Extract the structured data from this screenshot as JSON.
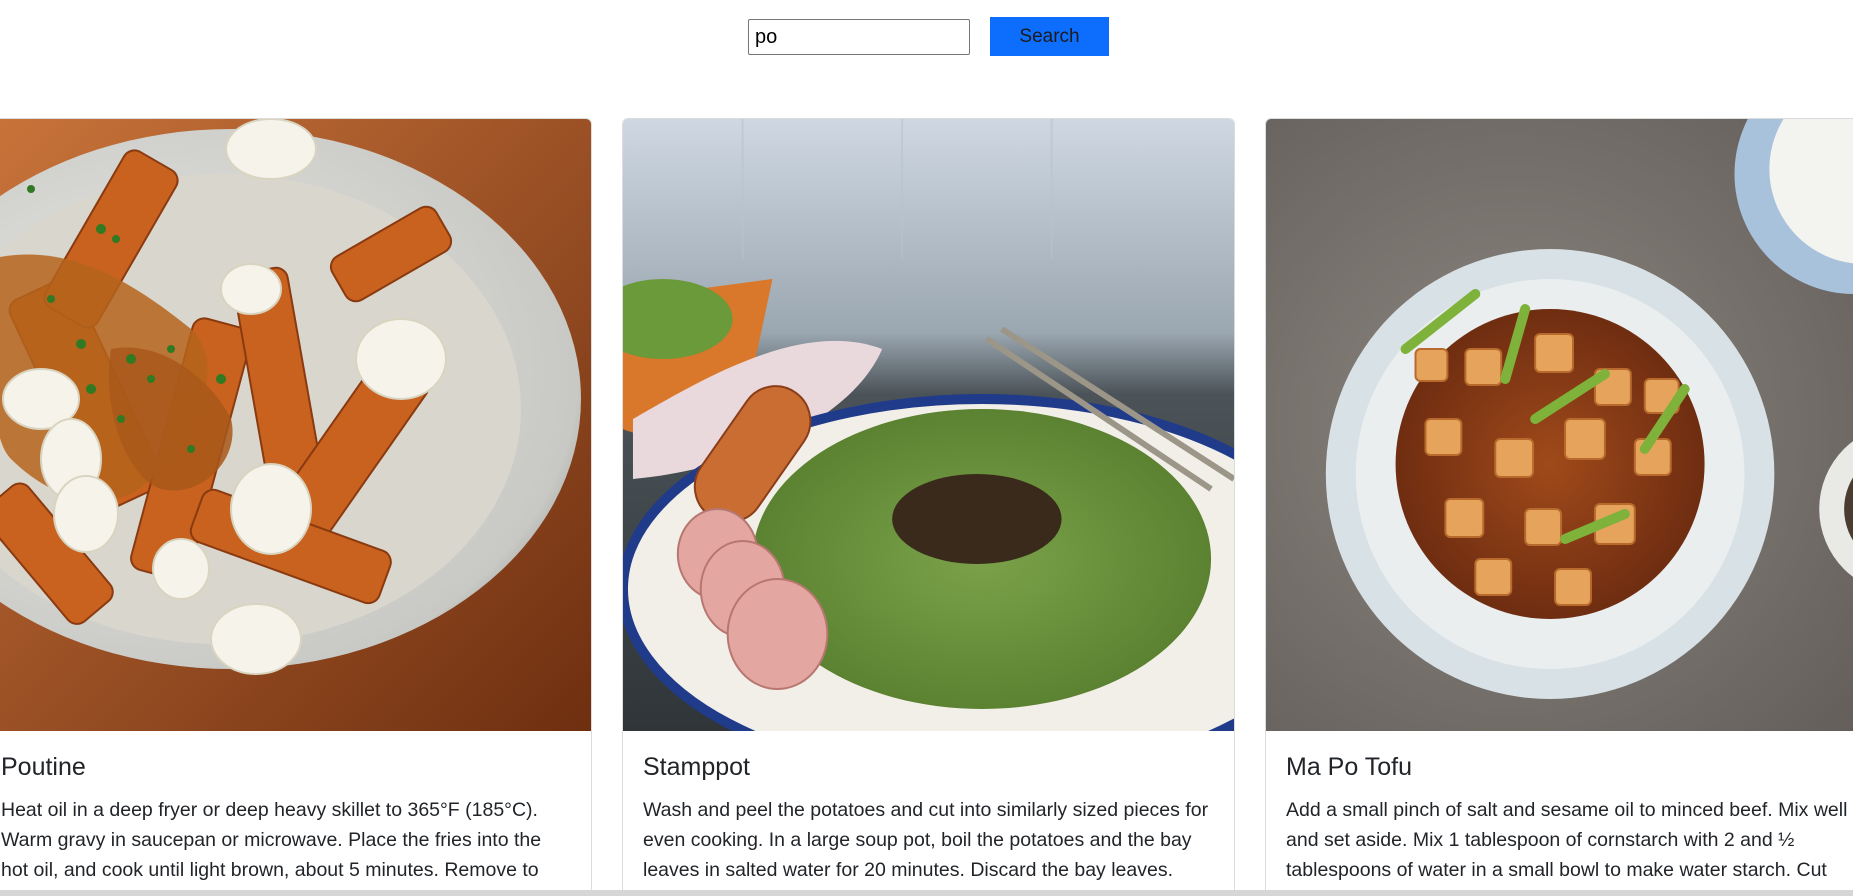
{
  "search": {
    "value": "po",
    "button_label": "Search"
  },
  "cards": [
    {
      "title": "Poutine",
      "image_icon": "poutine-photo",
      "text": "Heat oil in a deep fryer or deep heavy skillet to 365°F (185°C). Warm gravy in saucepan or microwave. Place the fries into the hot oil, and cook until light brown, about 5 minutes. Remove to"
    },
    {
      "title": "Stamppot",
      "image_icon": "stamppot-photo",
      "text": "Wash and peel the potatoes and cut into similarly sized pieces for even cooking. In a large soup pot, boil the potatoes and the bay leaves in salted water for 20 minutes. Discard the bay leaves."
    },
    {
      "title": "Ma Po Tofu",
      "image_icon": "mapo-tofu-photo",
      "text": "Add a small pinch of salt and sesame oil to minced beef. Mix well and set aside. Mix 1 tablespoon of cornstarch with 2 and ½ tablespoons of water in a small bowl to make water starch. Cut"
    }
  ],
  "colors": {
    "button_bg": "#0d6efd",
    "card_border": "#dcdcdc"
  }
}
